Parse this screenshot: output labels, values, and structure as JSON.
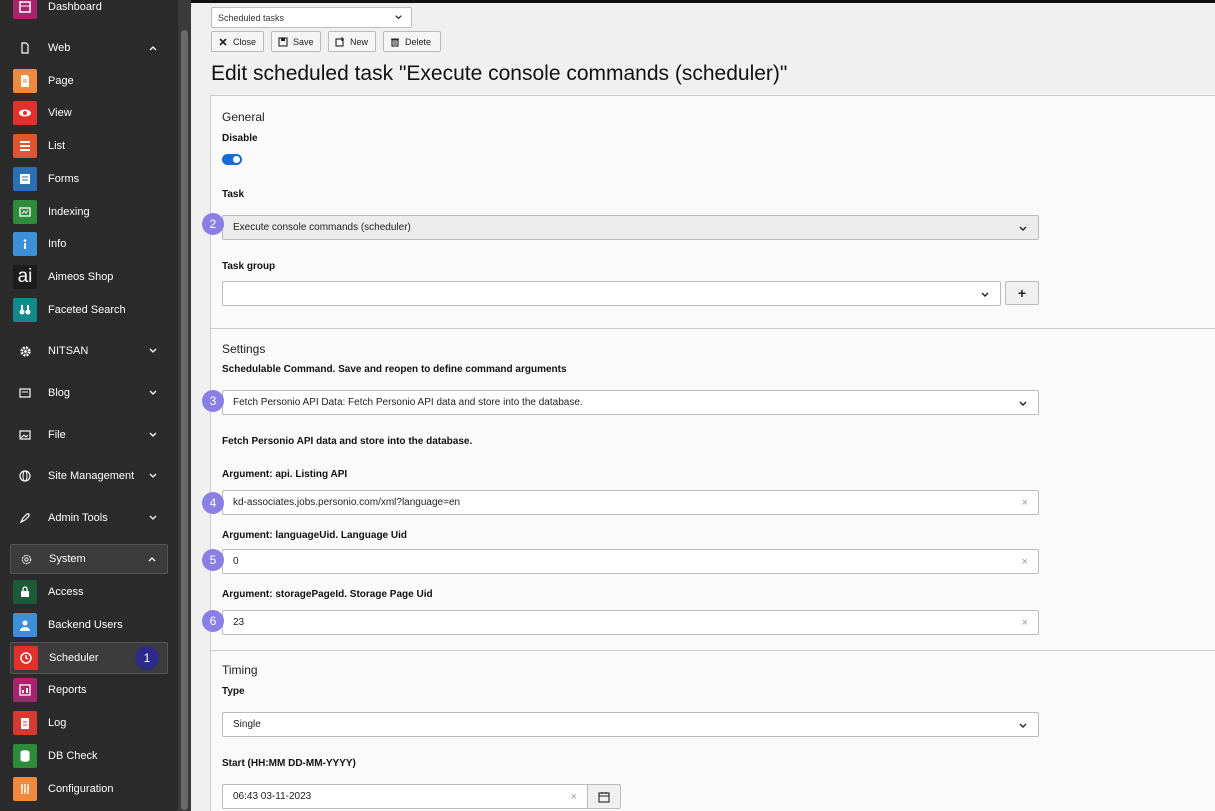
{
  "sidebar": {
    "dashboard": "Dashboard",
    "web_group": "Web",
    "page": "Page",
    "view": "View",
    "list": "List",
    "forms": "Forms",
    "indexing": "Indexing",
    "info": "Info",
    "aimeos": "Aimeos Shop",
    "faceted": "Faceted Search",
    "nitsan": "NITSAN",
    "blog": "Blog",
    "file": "File",
    "site_management": "Site Management",
    "admin_tools": "Admin Tools",
    "system_group": "System",
    "access": "Access",
    "backend_users": "Backend Users",
    "scheduler": "Scheduler",
    "scheduler_badge": "1",
    "reports": "Reports",
    "log": "Log",
    "db_check": "DB Check",
    "configuration": "Configuration",
    "aimeos_glyph": "ai"
  },
  "toolbar": {
    "module_select": "Scheduled tasks",
    "close": "Close",
    "save": "Save",
    "new": "New",
    "delete": "Delete"
  },
  "page_title": "Edit scheduled task \"Execute console commands (scheduler)\"",
  "general": {
    "heading": "General",
    "disable_label": "Disable",
    "task_label": "Task",
    "task_value": "Execute console commands (scheduler)",
    "task_group_label": "Task group",
    "task_group_value": "",
    "plus": "+"
  },
  "settings": {
    "heading": "Settings",
    "command_label": "Schedulable Command. Save and reopen to define command arguments",
    "command_value": "Fetch Personio API Data: Fetch Personio API data and store into the database.",
    "command_desc": "Fetch Personio API data and store into the database.",
    "arg_api_label": "Argument: api. Listing API",
    "arg_api_value": "kd-associates.jobs.personio.com/xml?language=en",
    "arg_lang_label": "Argument: languageUid. Language Uid",
    "arg_lang_value": "0",
    "arg_storage_label": "Argument: storagePageId. Storage Page Uid",
    "arg_storage_value": "23",
    "clear": "×"
  },
  "timing": {
    "heading": "Timing",
    "type_label": "Type",
    "type_value": "Single",
    "start_label": "Start (HH:MM DD-MM-YYYY)",
    "start_value": "06:43 03-11-2023"
  },
  "markers": [
    "2",
    "3",
    "4",
    "5",
    "6"
  ],
  "colors": {
    "accent": "#1a6ad6",
    "marker": "#8b7fe6",
    "badge": "#2e2a8a"
  }
}
